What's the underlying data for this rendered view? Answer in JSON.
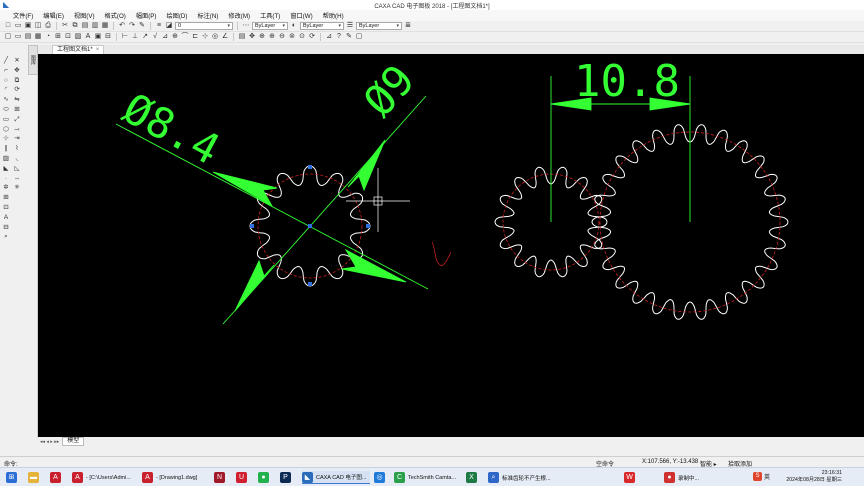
{
  "window": {
    "title": "CAXA CAD 电子图板 2018 - [工程图文档1*]"
  },
  "menu": [
    "文件(F)",
    "编辑(E)",
    "视图(V)",
    "格式(O)",
    "幅面(P)",
    "绘图(D)",
    "标注(N)",
    "修改(M)",
    "工具(T)",
    "窗口(W)",
    "帮助(H)"
  ],
  "toolbar": {
    "layer_dropdown": "0",
    "linetype_dropdown": "ByLayer",
    "color_dropdown": "ByLayer",
    "lineweight_dropdown": "ByLayer"
  },
  "panel_tab": "图库",
  "document_tab": {
    "label": "工程图文档1*",
    "close": "×"
  },
  "drawing": {
    "dimensions": [
      "Ø8.4",
      "Ø9",
      "10.8"
    ],
    "colors": {
      "dimension": "#33ff33",
      "gear": "#ffffff",
      "pitch_circle": "#d02020",
      "grip": "#2f6fe0"
    }
  },
  "bottom_tabs": {
    "nav": "◂◂ ◂ ▸ ▸▸",
    "model_tab": "模型"
  },
  "status": {
    "command": "命令:",
    "empty_command": "空命令",
    "coordinates": "X:107.566, Y:-13.438",
    "snap_mode": "智能 ▸",
    "capture": "拾取添加"
  },
  "taskbar": {
    "apps": [
      {
        "label": "",
        "icon": "windows-start-icon"
      },
      {
        "label": "",
        "icon": "file-explorer-icon"
      },
      {
        "label": "",
        "icon": "autocad-icon"
      },
      {
        "label": "- [C:\\Users\\Admi...",
        "icon": "autocad-icon"
      },
      {
        "label": "- [Drawing1.dwg]",
        "icon": "autocad-icon"
      },
      {
        "label": "",
        "icon": "nx-icon"
      },
      {
        "label": "",
        "icon": "ug-icon"
      },
      {
        "label": "",
        "icon": "wechat-icon"
      },
      {
        "label": "",
        "icon": "photoshop-icon"
      },
      {
        "label": "CAXA CAD 电子图...",
        "icon": "caxa-icon"
      },
      {
        "label": "",
        "icon": "browser-icon"
      },
      {
        "label": "TechSmith Camta...",
        "icon": "camtasia-icon"
      },
      {
        "label": "",
        "icon": "excel-icon"
      },
      {
        "label": "标准齿轮不产生根...",
        "icon": "search-icon"
      },
      {
        "label": "",
        "icon": "wps-icon"
      },
      {
        "label": "录制中...",
        "icon": "recording-icon"
      }
    ],
    "ime": "英",
    "time": "23:16:31",
    "date": "2024年08月28日 星期三"
  }
}
